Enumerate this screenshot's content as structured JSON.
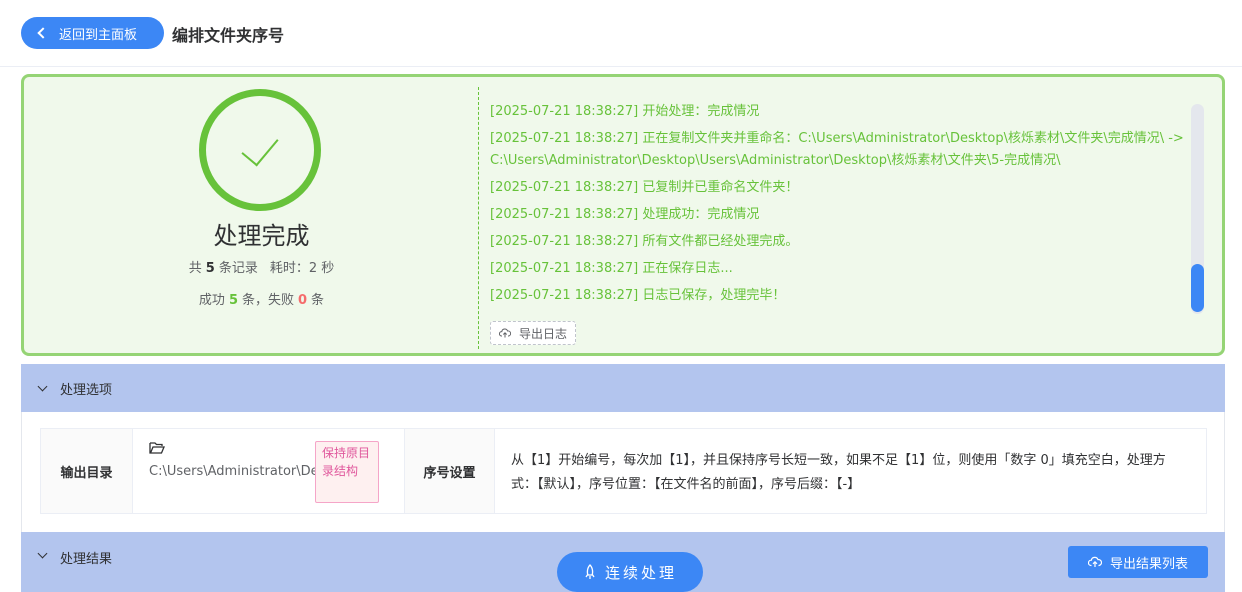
{
  "header": {
    "back_label": "返回到主面板",
    "title": "编排文件夹序号"
  },
  "result": {
    "title": "处理完成",
    "stats": {
      "total_prefix": "共",
      "total": "5",
      "total_suffix": "条记录",
      "time_label": "耗时：2 秒",
      "success_prefix": "成功",
      "success": "5",
      "success_suffix": "条，失败",
      "fail": "0",
      "fail_suffix": "条"
    },
    "logs": [
      "[2025-07-21 18:38:27] 开始处理：完成情况",
      "[2025-07-21 18:38:27] 正在复制文件夹并重命名：C:\\Users\\Administrator\\Desktop\\核烁素材\\文件夹\\完成情况\\ -> C:\\Users\\Administrator\\Desktop\\Users\\Administrator\\Desktop\\核烁素材\\文件夹\\5-完成情况\\",
      "[2025-07-21 18:38:27] 已复制并已重命名文件夹！",
      "[2025-07-21 18:38:27] 处理成功：完成情况",
      "[2025-07-21 18:38:27] 所有文件都已经处理完成。",
      "[2025-07-21 18:38:27] 正在保存日志...",
      "[2025-07-21 18:38:27] 日志已保存，处理完毕！"
    ],
    "export_log_label": "导出日志"
  },
  "options": {
    "section_label": "处理选项",
    "output_dir_label": "输出目录",
    "output_dir_path": "C:\\Users\\Administrator\\Desktop\\",
    "keep_structure_tag": "保持原目录结构",
    "seq_label": "序号设置",
    "seq_text": "从【1】开始编号，每次加【1】，并且保持序号长短一致，如果不足【1】位，则使用「数字 0」填充空白，处理方式：【默认】，序号位置：【在文件名的前面】，序号后缀：【-】"
  },
  "results_section": {
    "section_label": "处理结果",
    "continue_label": "连续处理",
    "export_result_label": "导出结果列表"
  },
  "colors": {
    "accent": "#3c87f5",
    "success": "#67c23a",
    "danger": "#f56c6c"
  }
}
